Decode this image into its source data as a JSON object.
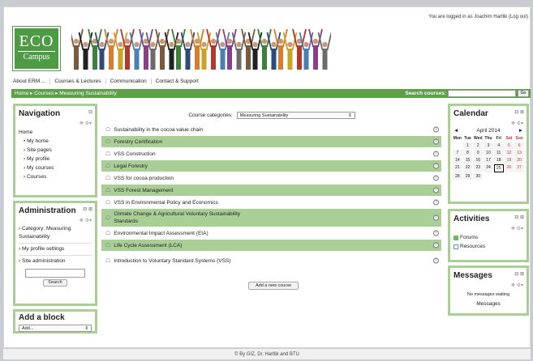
{
  "header": {
    "login_text": "You are logged in as Joachim Hartlik (Log out)",
    "logo_top": "ECO",
    "logo_bottom": "Campus",
    "menu": [
      "About ERM ...",
      "Courses & Lectures",
      "Communication",
      "Contact & Support"
    ]
  },
  "breadcrumb": {
    "text": "Home ▸ Courses ▸ Measuring Sustainability",
    "search_label": "Search courses:",
    "go_label": "Go"
  },
  "navigation": {
    "title": "Navigation",
    "home": "Home",
    "items": [
      "My home",
      "Site pages",
      "My profile",
      "My courses",
      "Courses"
    ]
  },
  "administration": {
    "title": "Administration",
    "items": [
      "Category: Measuring Sustainability",
      "My profile settings",
      "Site administration"
    ],
    "search_button": "Search"
  },
  "add_block": {
    "title": "Add a block",
    "select_value": "Add..."
  },
  "category": {
    "label": "Course categories:",
    "selected": "Measuring Sustainability"
  },
  "courses": [
    "Sustainability in the cocoa value chain",
    "Forestry Certification",
    "VSS Construction",
    "Legal Forestry",
    "VSS for cocoa production",
    "VSS Forest Management",
    "VSS in Environmental Policy and Economics",
    "Climate Change & Agricultural Voluntary Sustainability Standards",
    "Environmental Impact Assessment (EIA)",
    "Life Cycle Assessment (LCA)",
    "Introduction to Voluntary Standard Systems (VSS)"
  ],
  "add_course_button": "Add a new course",
  "calendar": {
    "title": "Calendar",
    "month": "April 2014",
    "prev": "◄",
    "next": "►",
    "days": [
      "Mon",
      "Tue",
      "Wed",
      "Thu",
      "Fri",
      "Sat",
      "Sun"
    ],
    "dates": [
      "",
      "1",
      "2",
      "3",
      "4",
      "5",
      "6",
      "7",
      "8",
      "9",
      "10",
      "11",
      "12",
      "13",
      "14",
      "15",
      "16",
      "17",
      "18",
      "19",
      "20",
      "21",
      "22",
      "23",
      "24",
      "25",
      "26",
      "27",
      "28",
      "29",
      "30"
    ],
    "today": "25"
  },
  "activities": {
    "title": "Activities",
    "items": [
      "Forums",
      "Resources"
    ]
  },
  "messages": {
    "title": "Messages",
    "status": "No messages waiting",
    "link": "Messages"
  },
  "footer": "© By GIZ, Dr. Hartlik and BTU",
  "colors": {
    "accent": "#5da048",
    "block_border": "#a9cf96",
    "logo_bg": "#4e9a45"
  }
}
